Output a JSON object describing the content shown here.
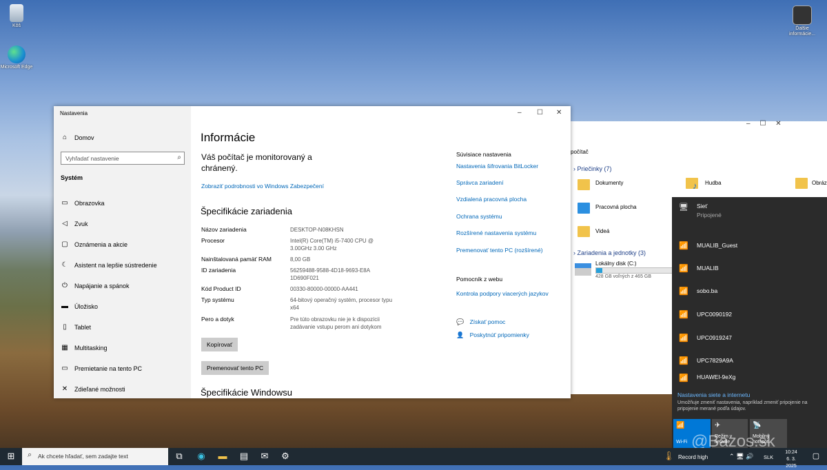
{
  "desktop": {
    "icons": [
      {
        "label": "Kôš",
        "icon": "recycle-bin-icon"
      },
      {
        "label": "Microsoft Edge",
        "icon": "edge-icon"
      },
      {
        "label": "Ďalšie informácie...",
        "icon": "info-icon"
      }
    ],
    "watermark": "@Bazos.sk"
  },
  "settings": {
    "window_title": "Nastavenia",
    "home_label": "Domov",
    "search_placeholder": "Vyhľadať nastavenie",
    "section_label": "Systém",
    "nav": [
      {
        "label": "Obrazovka",
        "icon": "monitor-icon"
      },
      {
        "label": "Zvuk",
        "icon": "speaker-icon"
      },
      {
        "label": "Oznámenia a akcie",
        "icon": "notification-icon"
      },
      {
        "label": "Asistent na lepšie sústredenie",
        "icon": "moon-icon"
      },
      {
        "label": "Napájanie a spánok",
        "icon": "power-icon"
      },
      {
        "label": "Úložisko",
        "icon": "storage-icon"
      },
      {
        "label": "Tablet",
        "icon": "tablet-icon"
      },
      {
        "label": "Multitasking",
        "icon": "multitasking-icon"
      },
      {
        "label": "Premietanie na tento PC",
        "icon": "projecting-icon"
      },
      {
        "label": "Zdieľané možnosti",
        "icon": "shared-experiences-icon"
      }
    ],
    "page_title": "Informácie",
    "protection_text": "Váš počítač je monitorovaný a chránený.",
    "protection_link": "Zobraziť podrobnosti vo Windows Zabezpečení",
    "device_spec_title": "Špecifikácie zariadenia",
    "specs": [
      {
        "label": "Názov zariadenia",
        "value": "DESKTOP-N08KHSN"
      },
      {
        "label": "Procesor",
        "value": "Intel(R) Core(TM) i5-7400 CPU @ 3.00GHz   3.00 GHz"
      },
      {
        "label": "Nainštalovaná pamäť RAM",
        "value": "8,00 GB"
      },
      {
        "label": "ID zariadenia",
        "value": "56259488-9588-4D18-9693-E8A1D690F021"
      },
      {
        "label": "Kód Product ID",
        "value": "00330-80000-00000-AA441"
      },
      {
        "label": "Typ systému",
        "value": "64-bitový operačný systém, procesor typu x64"
      },
      {
        "label": "Pero a dotyk",
        "value": "Pre túto obrazovku nie je k dispozícii zadávanie vstupu perom ani dotykom"
      }
    ],
    "copy_button": "Kopírovať",
    "rename_button": "Premenovať tento PC",
    "windows_spec_title": "Špecifikácie Windowsu",
    "related_title": "Súvisiace nastavenia",
    "related_links": [
      "Nastavenia šifrovania BitLocker",
      "Správca zariadení",
      "Vzdialená pracovná plocha",
      "Ochrana systému",
      "Rozšírené nastavenia systému",
      "Premenovať tento PC (rozšírené)"
    ],
    "help_title": "Pomocník z webu",
    "help_links": [
      "Kontrola podpory viacerých jazykov"
    ],
    "get_help": "Získať pomoc",
    "feedback": "Poskytnúť pripomienky",
    "accent": "#0067b8"
  },
  "explorer": {
    "address": "počítač",
    "folders_header": "Priečinky (7)",
    "folders": [
      "Dokumenty",
      "Hudba",
      "Obrázky",
      "Pracovná plocha",
      "Videá"
    ],
    "drives_header": "Zariadenia a jednotky (3)",
    "drive_name": "Lokálny disk (C:)",
    "drive_free": "428 GB voľných z 465 GB",
    "drive_used_fraction": 0.08
  },
  "network": {
    "connected_name": "Sieť",
    "connected_status": "Pripojené",
    "networks": [
      "MUALIB_Guest",
      "MUALIB",
      "sobo.ba",
      "UPC0090192",
      "UPC0919247",
      "UPC7829A9A",
      "HUAWEI-9eXg"
    ],
    "settings_title": "Nastavenia siete a internetu",
    "settings_desc": "Umožňuje zmeniť nastavenia, napríklad zmeniť pripojenie na pripojenie merané podľa údajov.",
    "quick_actions": [
      {
        "label": "Wi-Fi",
        "icon": "wifi-icon"
      },
      {
        "label": "Režim v lietadle",
        "icon": "airplane-icon"
      },
      {
        "label": "Mobilný hotspot",
        "icon": "hotspot-icon"
      }
    ]
  },
  "taskbar": {
    "search_placeholder": "Ak chcete hľadať, sem zadajte text",
    "weather": "Record high",
    "language": "SLK",
    "time": "10:24",
    "date": "6. 3. 2025"
  }
}
